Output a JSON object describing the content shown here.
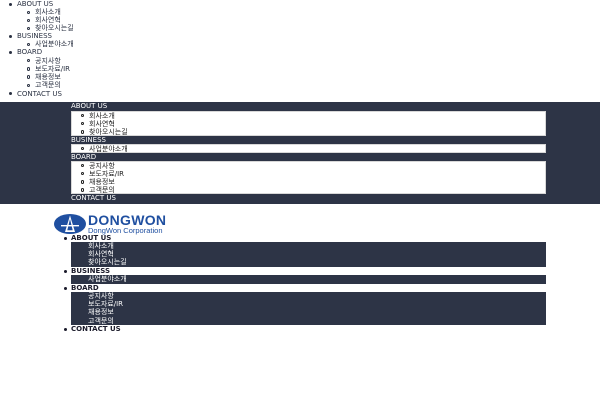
{
  "brand": {
    "name": "DONGWON",
    "tagline": "DongWon Corporation",
    "color": "#1f4fa0"
  },
  "theme": {
    "dark_band": "#2d3446",
    "text": "#2a3142"
  },
  "menu": [
    {
      "label": "ABOUT US",
      "items": [
        "회사소개",
        "회사연혁",
        "찾아오시는길"
      ]
    },
    {
      "label": "BUSINESS",
      "items": [
        "사업분야소개"
      ]
    },
    {
      "label": "BOARD",
      "items": [
        "공지사항",
        "보도자료/IR",
        "채용정보",
        "고객문의"
      ]
    },
    {
      "label": "CONTACT US",
      "items": []
    }
  ]
}
